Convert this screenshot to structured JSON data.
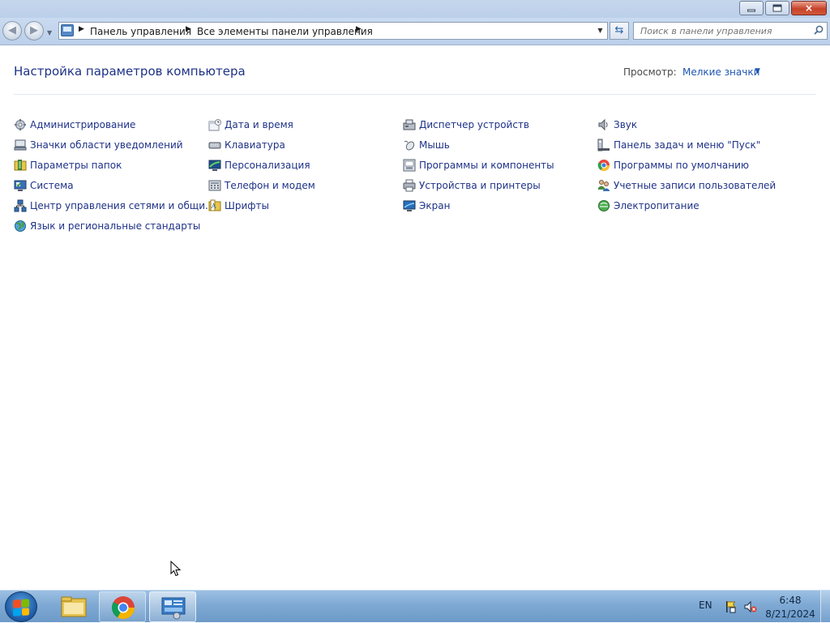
{
  "window": {
    "caption_buttons": {
      "minimize": "minimize-icon",
      "maximize": "restore-icon",
      "close": "×"
    }
  },
  "nav": {
    "back_icon": "back-arrow-icon",
    "forward_icon": "forward-arrow-icon",
    "breadcrumbs": [
      "Панель управления",
      "Все элементы панели управления"
    ],
    "search_placeholder": "Поиск в панели управления"
  },
  "content": {
    "title": "Настройка параметров компьютера",
    "view_label": "Просмотр:",
    "view_value": "Мелкие значки",
    "items": [
      {
        "label": "Администрирование",
        "icon": "admin-tools-icon"
      },
      {
        "label": "Значки области уведомлений",
        "icon": "notification-icons-icon"
      },
      {
        "label": "Параметры папок",
        "icon": "folder-options-icon"
      },
      {
        "label": "Система",
        "icon": "system-icon"
      },
      {
        "label": "Центр управления сетями и общи...",
        "icon": "network-center-icon"
      },
      {
        "label": "Язык и региональные стандарты",
        "icon": "region-language-icon"
      },
      {
        "label": "Дата и время",
        "icon": "date-time-icon"
      },
      {
        "label": "Клавиатура",
        "icon": "keyboard-icon"
      },
      {
        "label": "Персонализация",
        "icon": "personalization-icon"
      },
      {
        "label": "Телефон и модем",
        "icon": "phone-modem-icon"
      },
      {
        "label": "Шрифты",
        "icon": "fonts-icon"
      },
      {
        "label": "Диспетчер устройств",
        "icon": "device-manager-icon"
      },
      {
        "label": "Мышь",
        "icon": "mouse-icon"
      },
      {
        "label": "Программы и компоненты",
        "icon": "programs-features-icon"
      },
      {
        "label": "Устройства и принтеры",
        "icon": "devices-printers-icon"
      },
      {
        "label": "Экран",
        "icon": "display-icon"
      },
      {
        "label": "Звук",
        "icon": "sound-icon"
      },
      {
        "label": "Панель задач и меню \"Пуск\"",
        "icon": "taskbar-start-icon"
      },
      {
        "label": "Программы по умолчанию",
        "icon": "default-programs-icon"
      },
      {
        "label": "Учетные записи пользователей",
        "icon": "user-accounts-icon"
      },
      {
        "label": "Электропитание",
        "icon": "power-options-icon"
      }
    ]
  },
  "taskbar": {
    "apps": [
      {
        "name": "explorer",
        "icon": "folder-icon"
      },
      {
        "name": "chrome",
        "icon": "chrome-icon"
      },
      {
        "name": "control-panel",
        "icon": "control-panel-icon"
      }
    ],
    "language": "EN",
    "time": "6:48",
    "date": "8/21/2024"
  }
}
